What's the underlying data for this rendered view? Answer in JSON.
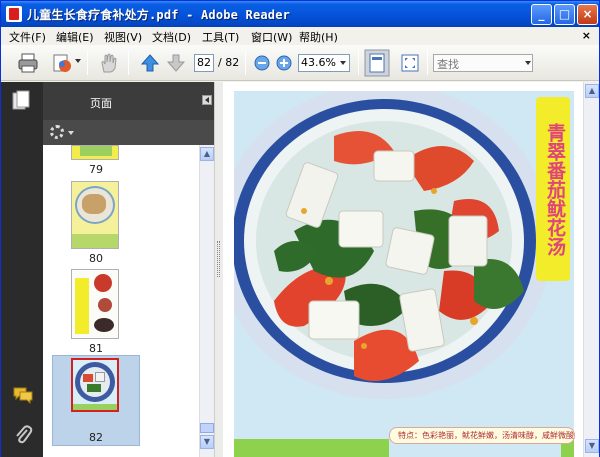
{
  "window": {
    "title": "儿童生长食疗食补处方.pdf - Adobe Reader",
    "controls": {
      "minimize": "_",
      "maximize": "□",
      "close": "×"
    }
  },
  "menu": {
    "items": [
      "文件(F)",
      "编辑(E)",
      "视图(V)",
      "文档(D)",
      "工具(T)",
      "窗口(W)",
      "帮助(H)"
    ],
    "close_glyph": "×"
  },
  "toolbar": {
    "current_page": "82",
    "total_pages": "/ 82",
    "zoom": "43.6%",
    "find_placeholder": "查找"
  },
  "pages_panel": {
    "title": "页面",
    "thumbnails": [
      {
        "label": "79"
      },
      {
        "label": "80"
      },
      {
        "label": "81"
      },
      {
        "label": "82",
        "selected": true
      }
    ]
  },
  "document": {
    "vertical_title": "青翠番茄鱿花汤",
    "caption": "特点：色彩艳丽，鱿花鲜嫩，汤清味醇，咸鲜微酸。"
  },
  "colors": {
    "titlebar": "#0554dc",
    "accent_yellow": "#f2ec2a",
    "title_pink": "#e0457a",
    "selection": "#bcd3ea"
  },
  "icons": [
    "print-icon",
    "email-icon",
    "hand-icon",
    "prev-page-icon",
    "next-page-icon",
    "zoom-out-icon",
    "zoom-in-icon",
    "fit-page-icon",
    "fullscreen-icon",
    "pages-icon",
    "comment-icon",
    "attachment-icon",
    "gear-icon"
  ]
}
